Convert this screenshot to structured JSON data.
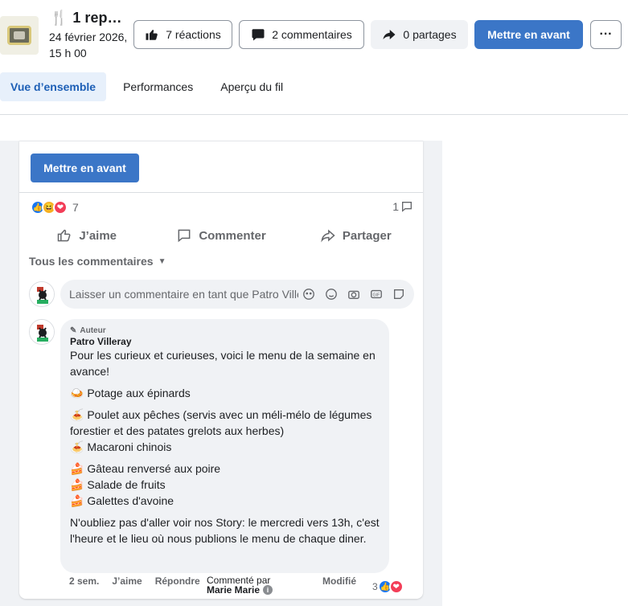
{
  "header": {
    "title": "1 rep…",
    "date": "24 février 2026, 15 h 00",
    "reactions_btn": "7 réactions",
    "comments_btn": "2 commentaires",
    "shares_btn": "0 partages",
    "boost_btn": "Mettre en avant",
    "more_btn": "···"
  },
  "tabs": [
    {
      "label": "Vue d’ensemble",
      "active": true
    },
    {
      "label": "Performances",
      "active": false
    },
    {
      "label": "Aperçu du fil",
      "active": false
    }
  ],
  "card": {
    "boost_btn": "Mettre en avant",
    "reaction_count": "7",
    "comment_count": "1",
    "actions": {
      "like": "J’aime",
      "comment": "Commenter",
      "share": "Partager"
    },
    "all_comments": "Tous les commentaires",
    "comment_placeholder": "Laisser un commentaire en tant que Patro Villeray"
  },
  "comment": {
    "badge": "Auteur",
    "author": "Patro Villeray",
    "intro": "Pour les curieux et curieuses, voici le menu de la semaine en avance!",
    "item1": "🍛 Potage aux épinards",
    "item2": "🍝 Poulet aux pêches (servis avec un méli-mélo de légumes forestier et des patates grelots aux herbes)",
    "item3": "🍝 Macaroni chinois",
    "item4": "🍰 Gâteau renversé aux poire",
    "item5": "🍰 Salade de fruits",
    "item6": "🍰 Galettes d'avoine",
    "outro": "N'oubliez pas d'aller voir nos Story: le mercredi vers 13h, c'est l'heure et le lieu où nous publions le menu de chaque diner.",
    "time": "2 sem.",
    "like": "J’aime",
    "reply": "Répondre",
    "commented_by": "Commenté par",
    "commenter": "Marie Marie",
    "edited": "Modifié",
    "reactions": "3"
  },
  "colors": {
    "accent": "#3b76c7",
    "like_blue": "#1877f2",
    "heart_red": "#f33e58",
    "haha_yellow": "#f7b125"
  }
}
